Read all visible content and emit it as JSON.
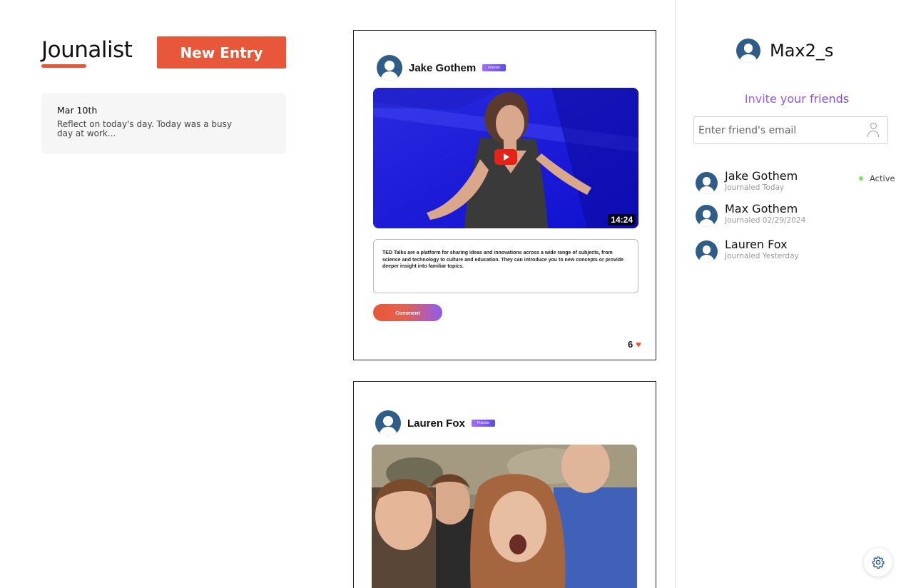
{
  "app": {
    "brand": "Jounalist",
    "new_entry_label": "New Entry"
  },
  "journal": {
    "entries": [
      {
        "date": "Mar 10th",
        "preview": "Reflect on today's day. Today was a busy day at work..."
      }
    ]
  },
  "feed": {
    "posts": [
      {
        "author": "Jake Gothem",
        "badge": "Friends",
        "media_type": "video",
        "duration": "14:24",
        "description": "TED Talks are a platform for sharing ideas and innovations across a wide range of subjects, from science and technology to culture and education. They can introduce you to new concepts or provide deeper insight into familiar topics.",
        "comment_label": "Comment",
        "likes": "6"
      },
      {
        "author": "Lauren Fox",
        "badge": "Friends",
        "media_type": "photo"
      }
    ]
  },
  "sidebar": {
    "username": "Max2_s",
    "invite_title": "Invite your friends",
    "email_placeholder": "Enter friend's email",
    "friends": [
      {
        "name": "Jake Gothem",
        "sub": "Journaled Today",
        "status": "Active"
      },
      {
        "name": "Max Gothem",
        "sub": "Journaled 02/29/2024"
      },
      {
        "name": "Lauren Fox",
        "sub": "Journaled Yesterday"
      }
    ]
  },
  "colors": {
    "accent": "#e8573a",
    "avatar": "#2f5d88",
    "active": "#7ee06c",
    "badge_start": "#a46ef5",
    "badge_end": "#5b4fe0"
  },
  "icons": {
    "avatar": "user-avatar-icon",
    "play": "play-icon",
    "heart": "heart-icon",
    "person": "person-icon",
    "settings": "gear-icon"
  }
}
